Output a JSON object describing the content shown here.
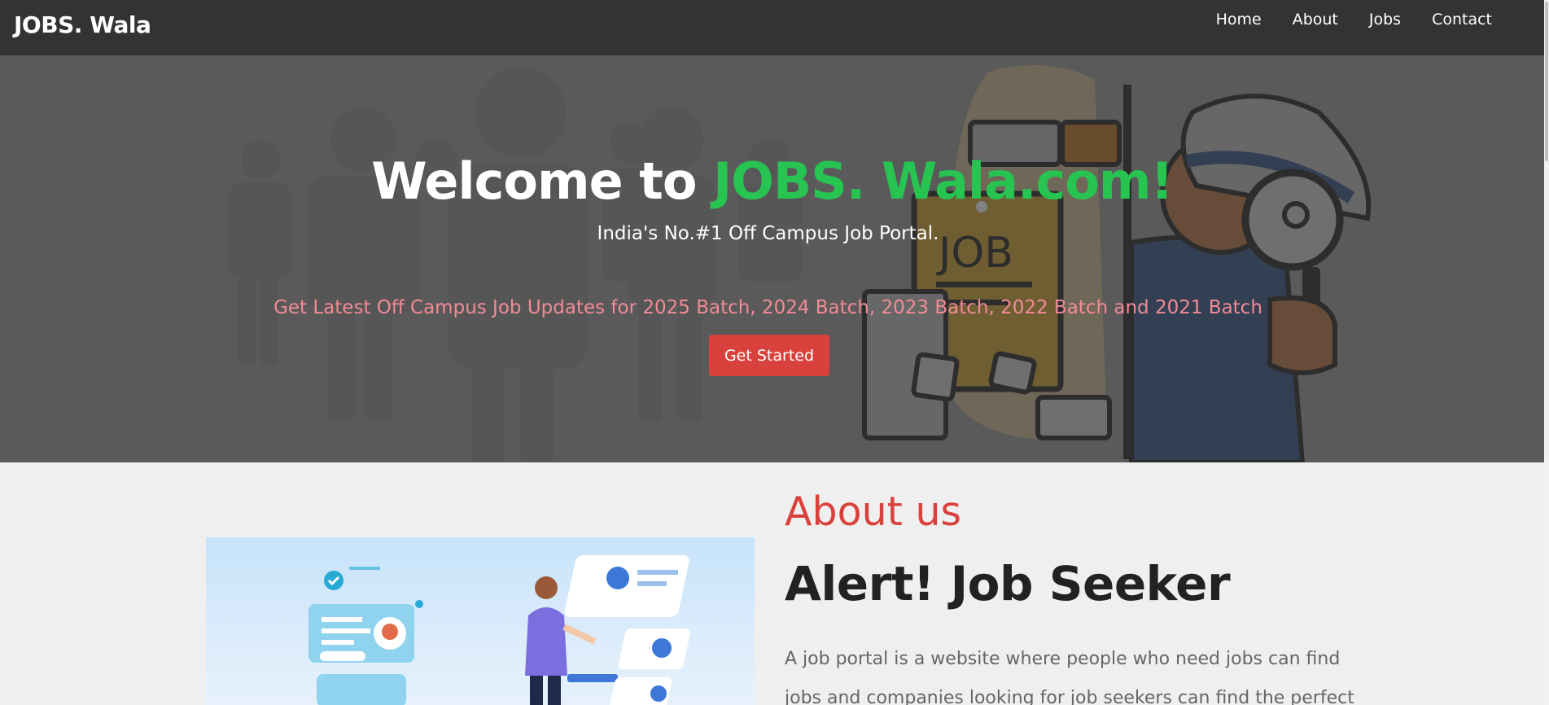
{
  "navbar": {
    "brand": "JOBS. Wala",
    "links": [
      "Home",
      "About",
      "Jobs",
      "Contact"
    ]
  },
  "hero": {
    "title_prefix": "Welcome to ",
    "title_accent": "JOBS. Wala.com!",
    "subtitle": "India's No.#1 Off Campus Job Portal.",
    "updates": "Get Latest Off Campus Job Updates for 2025 Batch, 2024 Batch, 2023 Batch, 2022 Batch and 2021 Batch",
    "cta_label": "Get Started",
    "badge_text": "JOB"
  },
  "about": {
    "eyebrow": "About us",
    "heading": "Alert! Job Seeker",
    "text": "A job portal is a website where people who need jobs can find jobs and companies looking for job seekers can find the perfect"
  },
  "colors": {
    "navbar": "#333333",
    "accent_green": "#27c452",
    "accent_red": "#d9413c",
    "updates_pink": "#f28b96",
    "page_bg": "#efefef"
  },
  "icons": {
    "hero_art": "detective-magnifier-job-illustration",
    "about_art": "job-seeker-profiles-illustration"
  }
}
